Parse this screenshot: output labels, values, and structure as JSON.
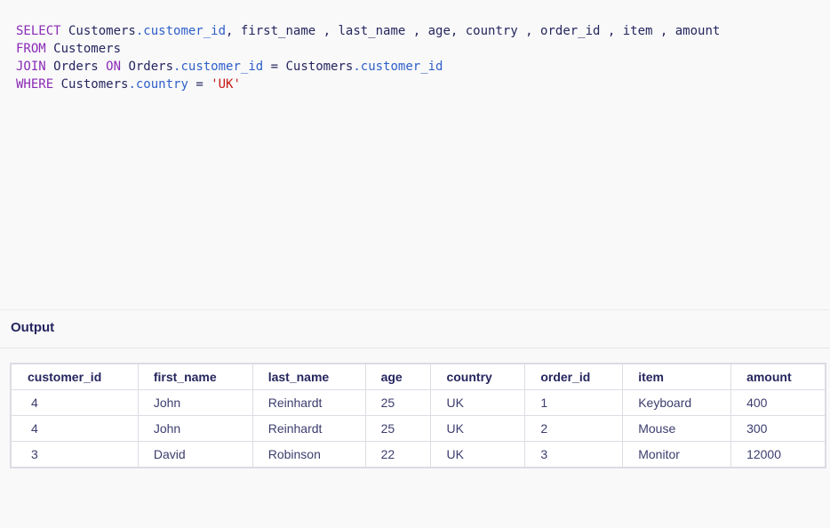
{
  "editor": {
    "lines": [
      [
        {
          "t": "SELECT",
          "c": "kw"
        },
        {
          "t": " Customers"
        },
        {
          "t": ".customer_id",
          "c": "prop"
        },
        {
          "t": ", first_name , last_name , age, country , order_id , item , amount"
        }
      ],
      [
        {
          "t": "FROM",
          "c": "kw"
        },
        {
          "t": " Customers"
        }
      ],
      [
        {
          "t": "JOIN",
          "c": "kw"
        },
        {
          "t": " Orders "
        },
        {
          "t": "ON",
          "c": "kw"
        },
        {
          "t": " Orders"
        },
        {
          "t": ".customer_id",
          "c": "prop"
        },
        {
          "t": " = Customers"
        },
        {
          "t": ".customer_id",
          "c": "prop"
        }
      ],
      [
        {
          "t": "WHERE",
          "c": "kw"
        },
        {
          "t": " Customers"
        },
        {
          "t": ".country",
          "c": "prop"
        },
        {
          "t": " = "
        },
        {
          "t": "'UK'",
          "c": "str"
        }
      ]
    ]
  },
  "output": {
    "title": "Output",
    "columns": [
      "customer_id",
      "first_name",
      "last_name",
      "age",
      "country",
      "order_id",
      "item",
      "amount"
    ],
    "rows": [
      [
        "4",
        "John",
        "Reinhardt",
        "25",
        "UK",
        "1",
        "Keyboard",
        "400"
      ],
      [
        "4",
        "John",
        "Reinhardt",
        "25",
        "UK",
        "2",
        "Mouse",
        "300"
      ],
      [
        "3",
        "David",
        "Robinson",
        "22",
        "UK",
        "3",
        "Monitor",
        "12000"
      ]
    ]
  },
  "colors": {
    "keyword": "#8a2bb5",
    "property": "#2f5fc8",
    "string": "#c41a16",
    "text": "#25265e"
  }
}
